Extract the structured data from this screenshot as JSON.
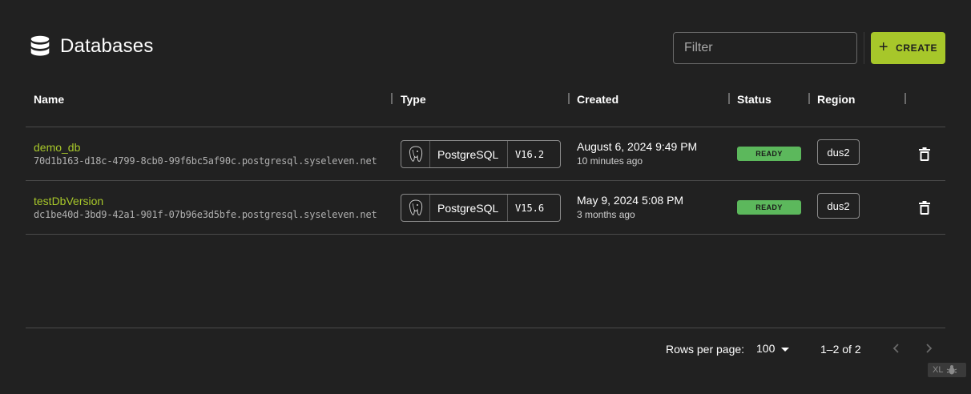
{
  "header": {
    "icon": "database-icon",
    "title": "Databases",
    "filter_placeholder": "Filter",
    "create_label": "CREATE"
  },
  "table": {
    "columns": [
      "Name",
      "Type",
      "Created",
      "Status",
      "Region"
    ],
    "rows": [
      {
        "name": "demo_db",
        "host": "70d1b163-d18c-4799-8cb0-99f6bc5af90c.postgresql.syseleven.net",
        "type": "PostgreSQL",
        "version": "V16.2",
        "created_date": "August 6, 2024 9:49 PM",
        "created_ago": "10 minutes ago",
        "status": "READY",
        "region": "dus2"
      },
      {
        "name": "testDbVersion",
        "host": "dc1be40d-3bd9-42a1-901f-07b96e3d5bfe.postgresql.syseleven.net",
        "type": "PostgreSQL",
        "version": "V15.6",
        "created_date": "May 9, 2024 5:08 PM",
        "created_ago": "3 months ago",
        "status": "READY",
        "region": "dus2"
      }
    ]
  },
  "pagination": {
    "rows_per_page_label": "Rows per page:",
    "rows_per_page_value": "100",
    "range": "1–2 of 2"
  },
  "badge": {
    "label": "XL"
  },
  "colors": {
    "background": "#212121",
    "accent": "#a7c72a",
    "status_ready": "#5cb85c"
  }
}
